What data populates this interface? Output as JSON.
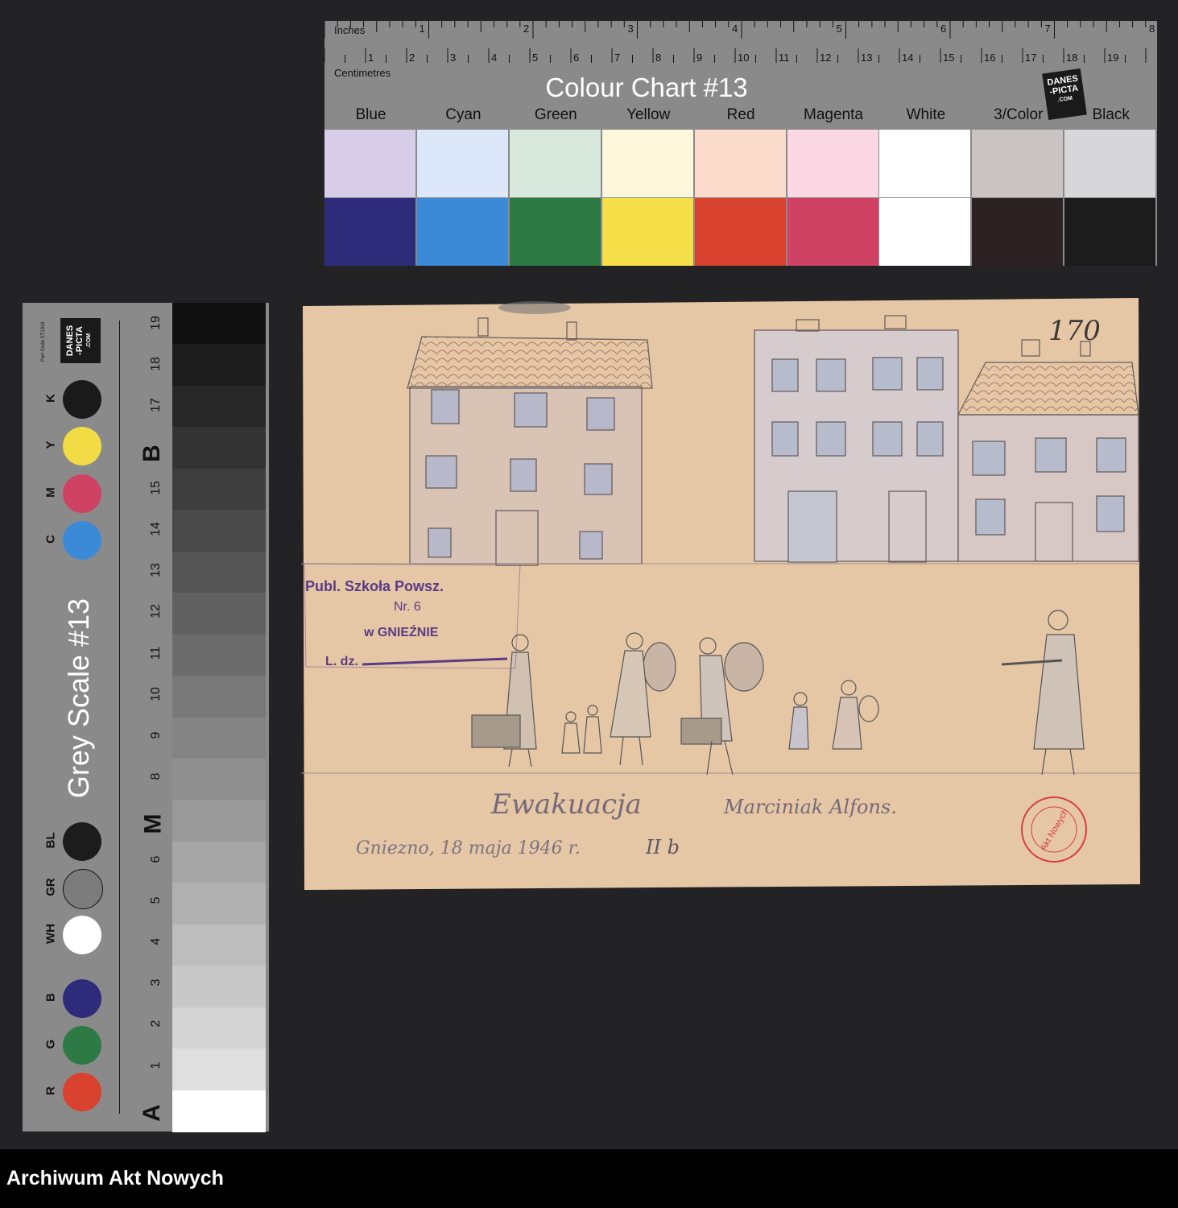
{
  "colour_chart": {
    "title": "Colour Chart #13",
    "inches_label": "Inches",
    "centimetres_label": "Centimetres",
    "inch_numbers": [
      "1",
      "2",
      "3",
      "4",
      "5",
      "6",
      "7",
      "8"
    ],
    "cm_numbers": [
      "1",
      "2",
      "3",
      "4",
      "5",
      "6",
      "7",
      "8",
      "9",
      "10",
      "11",
      "12",
      "13",
      "14",
      "15",
      "16",
      "17",
      "18",
      "19"
    ],
    "logo_lines": [
      "DANES",
      "-PICTA",
      ".COM"
    ],
    "swatches": [
      {
        "name": "Blue",
        "light": "#d8cde8",
        "dark": "#2e2c7a"
      },
      {
        "name": "Cyan",
        "light": "#dce8fa",
        "dark": "#3a8ad8"
      },
      {
        "name": "Green",
        "light": "#d9e8dc",
        "dark": "#2e7a45"
      },
      {
        "name": "Yellow",
        "light": "#fdf8dc",
        "dark": "#f7df4a"
      },
      {
        "name": "Red",
        "light": "#fbdccd",
        "dark": "#d8422f"
      },
      {
        "name": "Magenta",
        "light": "#fbd8e4",
        "dark": "#cf4263"
      },
      {
        "name": "White",
        "light": "#ffffff",
        "dark": "#ffffff"
      },
      {
        "name": "3/Color",
        "light": "#c9c3c2",
        "dark": "#2c2224"
      },
      {
        "name": "Black",
        "light": "#d7d7d9",
        "dark": "#1c1c1c"
      }
    ]
  },
  "grey_scale": {
    "title": "Grey Scale #13",
    "part_code": "Part Code ST1316",
    "logo_lines": [
      "DANES",
      "-PICTA",
      ".COM"
    ],
    "dots": [
      {
        "label": "K",
        "color": "#1a1a1a"
      },
      {
        "label": "Y",
        "color": "#f2dc45"
      },
      {
        "label": "M",
        "color": "#cf4263"
      },
      {
        "label": "C",
        "color": "#3a8ad8"
      },
      {
        "label": "BL",
        "color": "#1c1c1c"
      },
      {
        "label": "GR",
        "color": "#7c7c7c"
      },
      {
        "label": "WH",
        "color": "#ffffff"
      },
      {
        "label": "B",
        "color": "#2e2c7a"
      },
      {
        "label": "G",
        "color": "#2e7a45"
      },
      {
        "label": "R",
        "color": "#d8422f"
      }
    ],
    "numbers": [
      "19",
      "18",
      "17",
      "B",
      "15",
      "14",
      "13",
      "12",
      "11",
      "10",
      "9",
      "8",
      "M",
      "6",
      "5",
      "4",
      "3",
      "2",
      "1",
      "A"
    ]
  },
  "drawing": {
    "page_number": "170",
    "stamp_line1": "Publ. Szkoła Powsz.",
    "stamp_line2": "Nr. 6",
    "stamp_line3": "w GNIEŹNIE",
    "stamp_line4": "L. dz.",
    "caption_title": "Ewakuacja",
    "caption_author": "Marciniak Alfons.",
    "caption_place_date": "Gniezno, 18 maja 1946 r.",
    "caption_class": "II b",
    "red_stamp_text": "Akt Nowych"
  },
  "footer": {
    "text": "Archiwum Akt Nowych"
  }
}
